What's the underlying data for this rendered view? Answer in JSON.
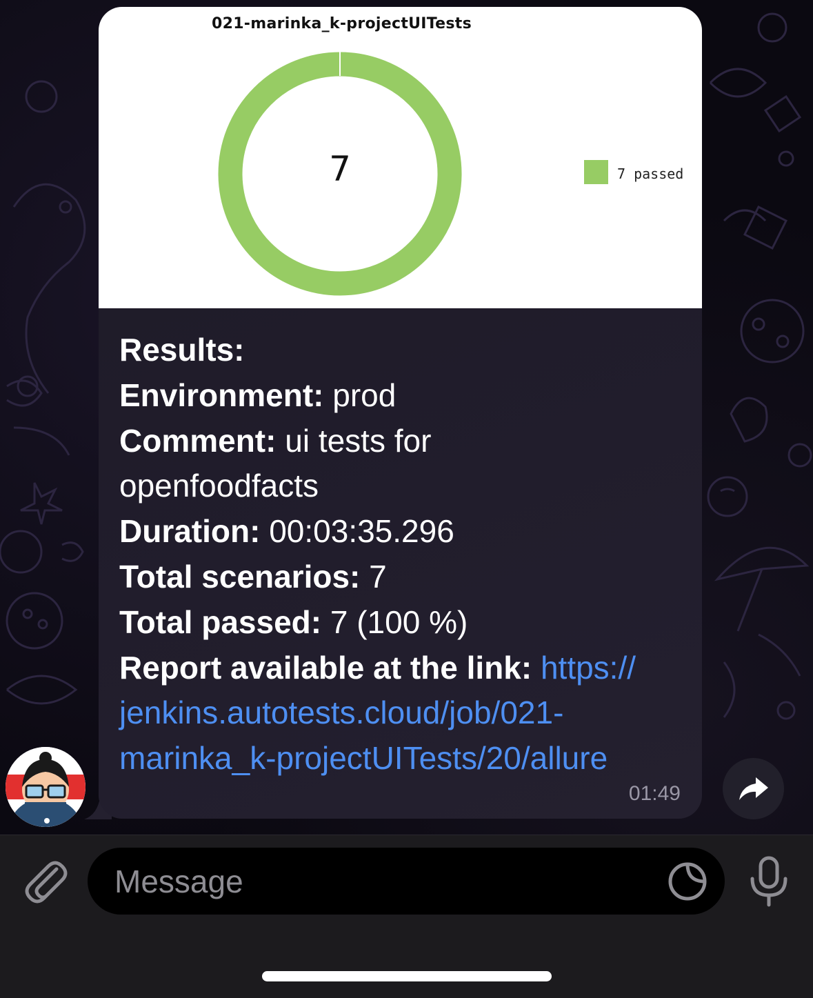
{
  "app": "Telegram",
  "message": {
    "chart_image": {
      "chart_data": {
        "type": "pie",
        "title": "021-marinka_k-projectUITests",
        "center_label": "7",
        "slices": [
          {
            "label": "7 passed",
            "value": 7,
            "color": "#97cc64"
          }
        ],
        "legend": [
          "7 passed"
        ],
        "legend_placement": "right"
      }
    },
    "results_label": "Results:",
    "environment_label": "Environment:",
    "environment_value": "prod",
    "comment_label": "Comment:",
    "comment_value_line1": "ui tests for",
    "comment_value_line2": "openfoodfacts",
    "duration_label": "Duration:",
    "duration_value": "00:03:35.296",
    "total_scenarios_label": "Total scenarios:",
    "total_scenarios_value": "7",
    "total_passed_label": "Total passed:",
    "total_passed_value": "7 (100 %)",
    "report_label": "Report available at the link:",
    "report_link_line1": "https://",
    "report_link_line2": "jenkins.autotests.cloud/job/021-",
    "report_link_line3": "marinka_k-projectUITests/20/allure",
    "time": "01:49"
  },
  "avatar_icon": "avatar-cartoon-girl-glasses",
  "forward_icon": "share-arrow-icon",
  "composer": {
    "attach_icon": "paperclip-icon",
    "placeholder": "Message",
    "sticker_icon": "sticker-icon",
    "mic_icon": "microphone-icon"
  },
  "colors": {
    "background": "#0b0911",
    "bubble": "#211d2c",
    "link": "#4e8ff2",
    "passed": "#97cc64"
  }
}
